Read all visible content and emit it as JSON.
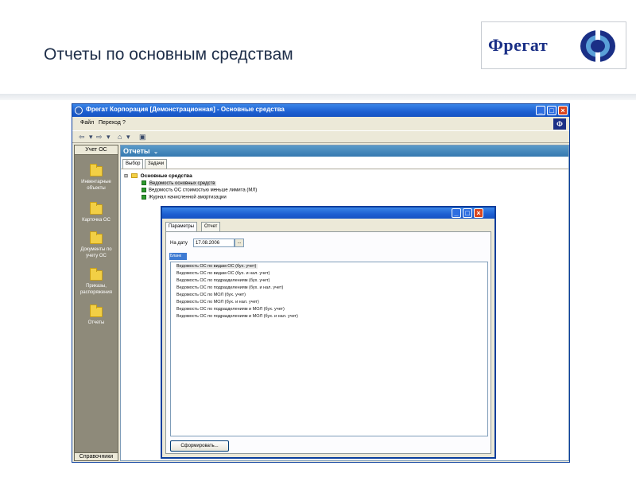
{
  "slide": {
    "title": "Отчеты по основным средствам",
    "logo_text": "Фрегат"
  },
  "window": {
    "title": "Фрегат Корпорация [Демонстрационная] - Основные средства",
    "buttons": {
      "minimize": "_",
      "maximize": "□",
      "close": "×"
    },
    "menu": [
      "Файл",
      "Переход",
      "?"
    ],
    "menu_logo": "Ф",
    "toolbar": {
      "back": "⇦",
      "back_dd": "▾",
      "forward": "⇨",
      "forward_dd": "▾",
      "home": "⌂",
      "home_dd": "▾",
      "panel": "▣"
    }
  },
  "left_pane": {
    "header": "Учет ОС",
    "items": [
      {
        "label": "Инвентарные объекты"
      },
      {
        "label": "Карточка ОС"
      },
      {
        "label": "Документы по учету ОС"
      },
      {
        "label": "Приказы, распоряжения"
      },
      {
        "label": "Отчеты"
      }
    ],
    "footer": "Справочники"
  },
  "right_pane": {
    "header": "Отчеты",
    "header_arrow": "⌄",
    "tabs": [
      "Выбор",
      "Задачи"
    ],
    "tree": {
      "root_toggle": "⊟",
      "root": "Основные средства",
      "children": [
        "Ведомость основных средств",
        "Ведомость ОС стоимостью меньше лимита (МЛ)",
        "Журнал начисленной амортизации"
      ],
      "selected_index": 0
    }
  },
  "dialog": {
    "buttons": {
      "minimize": "_",
      "maximize": "□",
      "close": "×"
    },
    "tabs": [
      "Параметры",
      "Отчет"
    ],
    "date_label": "На дату",
    "date_value": "17.08.2006",
    "date_button": "...",
    "section_label": "Бланк",
    "blanks": [
      "Ведомость ОС по видам ОС (бух. учет)",
      "Ведомость ОС по видам ОС (бух. и нал. учет)",
      "Ведомость ОС по подразделениям (бух. учет)",
      "Ведомость ОС по подразделениям (бух. и нал. учет)",
      "Ведомость ОС по МОЛ (бух. учет)",
      "Ведомость ОС по МОЛ (бух. и нал. учет)",
      "Ведомость ОС по подразделениям и МОЛ (бух. учет)",
      "Ведомость ОС по подразделениям и МОЛ (бух. и нал. учет)"
    ],
    "selected_blank": 0,
    "submit_label": "Сформировать..."
  },
  "colors": {
    "titlebar": "#1d5fd1",
    "left_pane": "#8e8a7a",
    "pane_header": "#3579b0",
    "logo_blue": "#1a2f86",
    "tree_icon": "#2e9a2e"
  }
}
